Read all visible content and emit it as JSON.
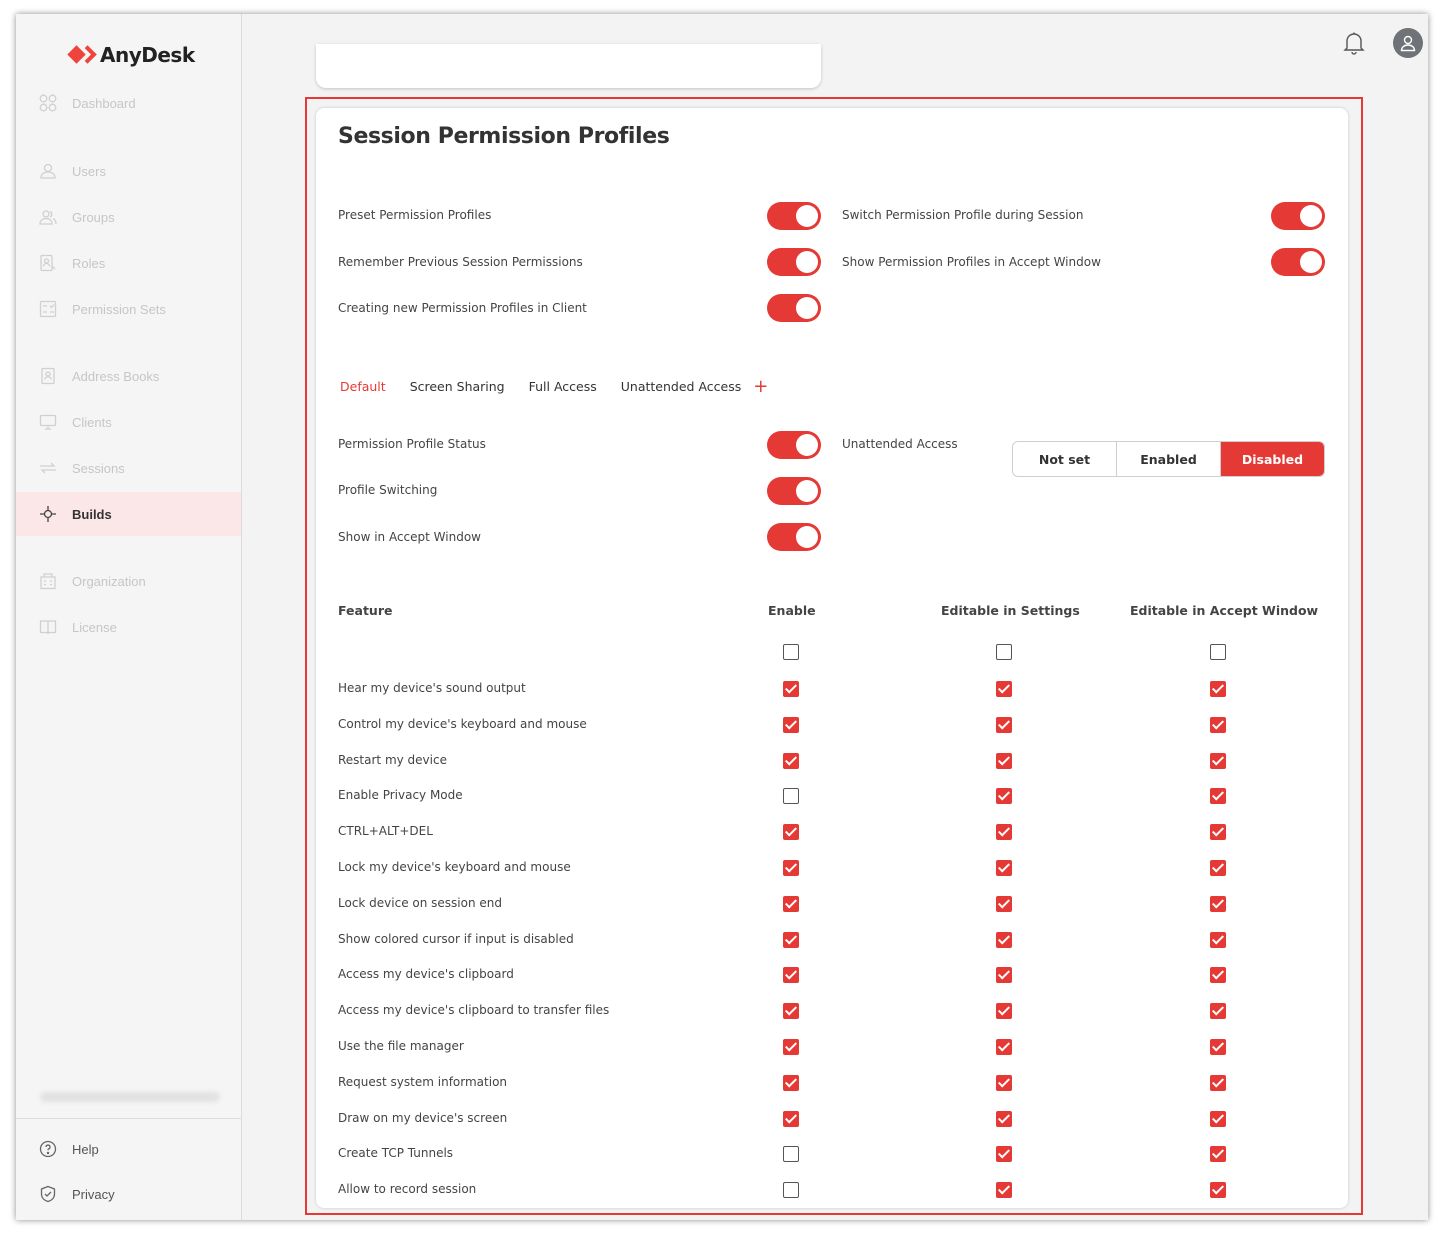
{
  "app": {
    "logo_text": "AnyDesk",
    "accent": "#e53935"
  },
  "sidebar": {
    "items": [
      {
        "label": "Dashboard",
        "icon": "dashboard-icon"
      },
      {
        "label": "Users",
        "icon": "user-icon"
      },
      {
        "label": "Groups",
        "icon": "group-icon"
      },
      {
        "label": "Roles",
        "icon": "roles-icon"
      },
      {
        "label": "Permission Sets",
        "icon": "permission-sets-icon"
      },
      {
        "label": "Address Books",
        "icon": "address-book-icon"
      },
      {
        "label": "Clients",
        "icon": "monitor-icon"
      },
      {
        "label": "Sessions",
        "icon": "sessions-icon"
      },
      {
        "label": "Builds",
        "icon": "builds-icon",
        "active": true
      },
      {
        "label": "Organization",
        "icon": "organization-icon"
      },
      {
        "label": "License",
        "icon": "license-icon"
      }
    ],
    "bottom": [
      {
        "label": "Help",
        "icon": "help-icon"
      },
      {
        "label": "Privacy",
        "icon": "privacy-shield-icon"
      }
    ]
  },
  "header": {
    "icons": [
      "bell-icon",
      "account-icon"
    ]
  },
  "section": {
    "title": "Session Permission Profiles",
    "global_toggles": [
      {
        "label": "Preset Permission Profiles",
        "on": true
      },
      {
        "label": "Switch Permission Profile during Session",
        "on": true
      },
      {
        "label": "Remember Previous Session Permissions",
        "on": true
      },
      {
        "label": "Show Permission Profiles in Accept Window",
        "on": true
      },
      {
        "label": "Creating new Permission Profiles in Client",
        "on": true
      }
    ],
    "tabs": [
      "Default",
      "Screen Sharing",
      "Full Access",
      "Unattended Access"
    ],
    "active_tab": "Default",
    "add_tab_symbol": "+",
    "profile_toggles": [
      {
        "label": "Permission Profile Status",
        "on": true
      },
      {
        "label": "Profile Switching",
        "on": true
      },
      {
        "label": "Show in Accept Window",
        "on": true
      }
    ],
    "unattended_access": {
      "label": "Unattended Access",
      "options": [
        "Not set",
        "Enabled",
        "Disabled"
      ],
      "selected": "Disabled"
    }
  },
  "table": {
    "headers": {
      "feature": "Feature",
      "enable": "Enable",
      "editable_settings": "Editable in Settings",
      "editable_accept": "Editable in Accept Window"
    },
    "select_all": [
      false,
      false,
      false
    ],
    "rows": [
      {
        "feature": "Hear my device's sound output",
        "values": [
          true,
          true,
          true
        ]
      },
      {
        "feature": "Control my device's keyboard and mouse",
        "values": [
          true,
          true,
          true
        ]
      },
      {
        "feature": "Restart my device",
        "values": [
          true,
          true,
          true
        ]
      },
      {
        "feature": "Enable Privacy Mode",
        "values": [
          false,
          true,
          true
        ]
      },
      {
        "feature": "CTRL+ALT+DEL",
        "values": [
          true,
          true,
          true
        ]
      },
      {
        "feature": "Lock my device's keyboard and mouse",
        "values": [
          true,
          true,
          true
        ]
      },
      {
        "feature": "Lock device on session end",
        "values": [
          true,
          true,
          true
        ]
      },
      {
        "feature": "Show colored cursor if input is disabled",
        "values": [
          true,
          true,
          true
        ]
      },
      {
        "feature": "Access my device's clipboard",
        "values": [
          true,
          true,
          true
        ]
      },
      {
        "feature": "Access my device's clipboard to transfer files",
        "values": [
          true,
          true,
          true
        ]
      },
      {
        "feature": "Use the file manager",
        "values": [
          true,
          true,
          true
        ]
      },
      {
        "feature": "Request system information",
        "values": [
          true,
          true,
          true
        ]
      },
      {
        "feature": "Draw on my device's screen",
        "values": [
          true,
          true,
          true
        ]
      },
      {
        "feature": "Create TCP Tunnels",
        "values": [
          false,
          true,
          true
        ]
      },
      {
        "feature": "Allow to record session",
        "values": [
          false,
          true,
          true
        ]
      }
    ]
  }
}
